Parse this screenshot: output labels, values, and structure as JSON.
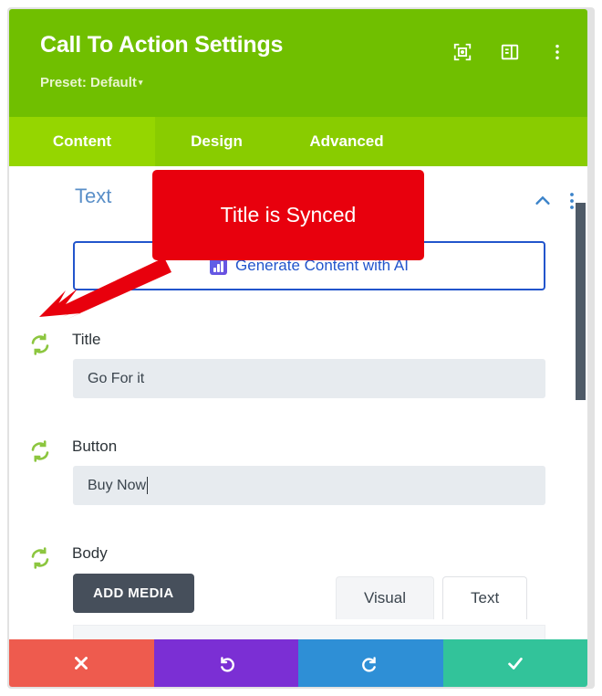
{
  "header": {
    "title": "Call To Action Settings",
    "preset_label": "Preset: Default",
    "preset_caret": "▾",
    "icons": [
      {
        "name": "focus-target-icon"
      },
      {
        "name": "layout-panel-icon"
      },
      {
        "name": "more-vertical-icon"
      }
    ],
    "bg_color": "#70bf00"
  },
  "tabs": {
    "items": [
      {
        "label": "Content",
        "active": true
      },
      {
        "label": "Design",
        "active": false
      },
      {
        "label": "Advanced",
        "active": false
      }
    ],
    "bg_color": "#89cc00",
    "active_color": "#95d600"
  },
  "content": {
    "section_title": "Text",
    "ai_button_label": "Generate Content with AI",
    "ai_button_border_color": "#2255cc",
    "fields": [
      {
        "label": "Title",
        "value": "Go For it",
        "synced": true,
        "caret": false
      },
      {
        "label": "Button",
        "value": "Buy Now",
        "synced": true,
        "caret": true
      },
      {
        "label": "Body",
        "value": "",
        "synced": true,
        "caret": false
      }
    ],
    "add_media_label": "ADD MEDIA",
    "editor_tabs": [
      {
        "label": "Visual",
        "active": true
      },
      {
        "label": "Text",
        "active": false
      }
    ],
    "sync_icon_color": "#8cc63f"
  },
  "bottom_bar": {
    "buttons": [
      {
        "name": "cancel-button",
        "icon": "close-icon",
        "color": "#ee5b4e"
      },
      {
        "name": "undo-button",
        "icon": "undo-icon",
        "color": "#7b2fd4"
      },
      {
        "name": "redo-button",
        "icon": "redo-icon",
        "color": "#2e8fd6"
      },
      {
        "name": "save-button",
        "icon": "check-icon",
        "color": "#32c39a"
      }
    ]
  },
  "annotation": {
    "callout_text": "Title is Synced",
    "callout_color": "#e8000d",
    "arrow_color": "#e8000d"
  }
}
